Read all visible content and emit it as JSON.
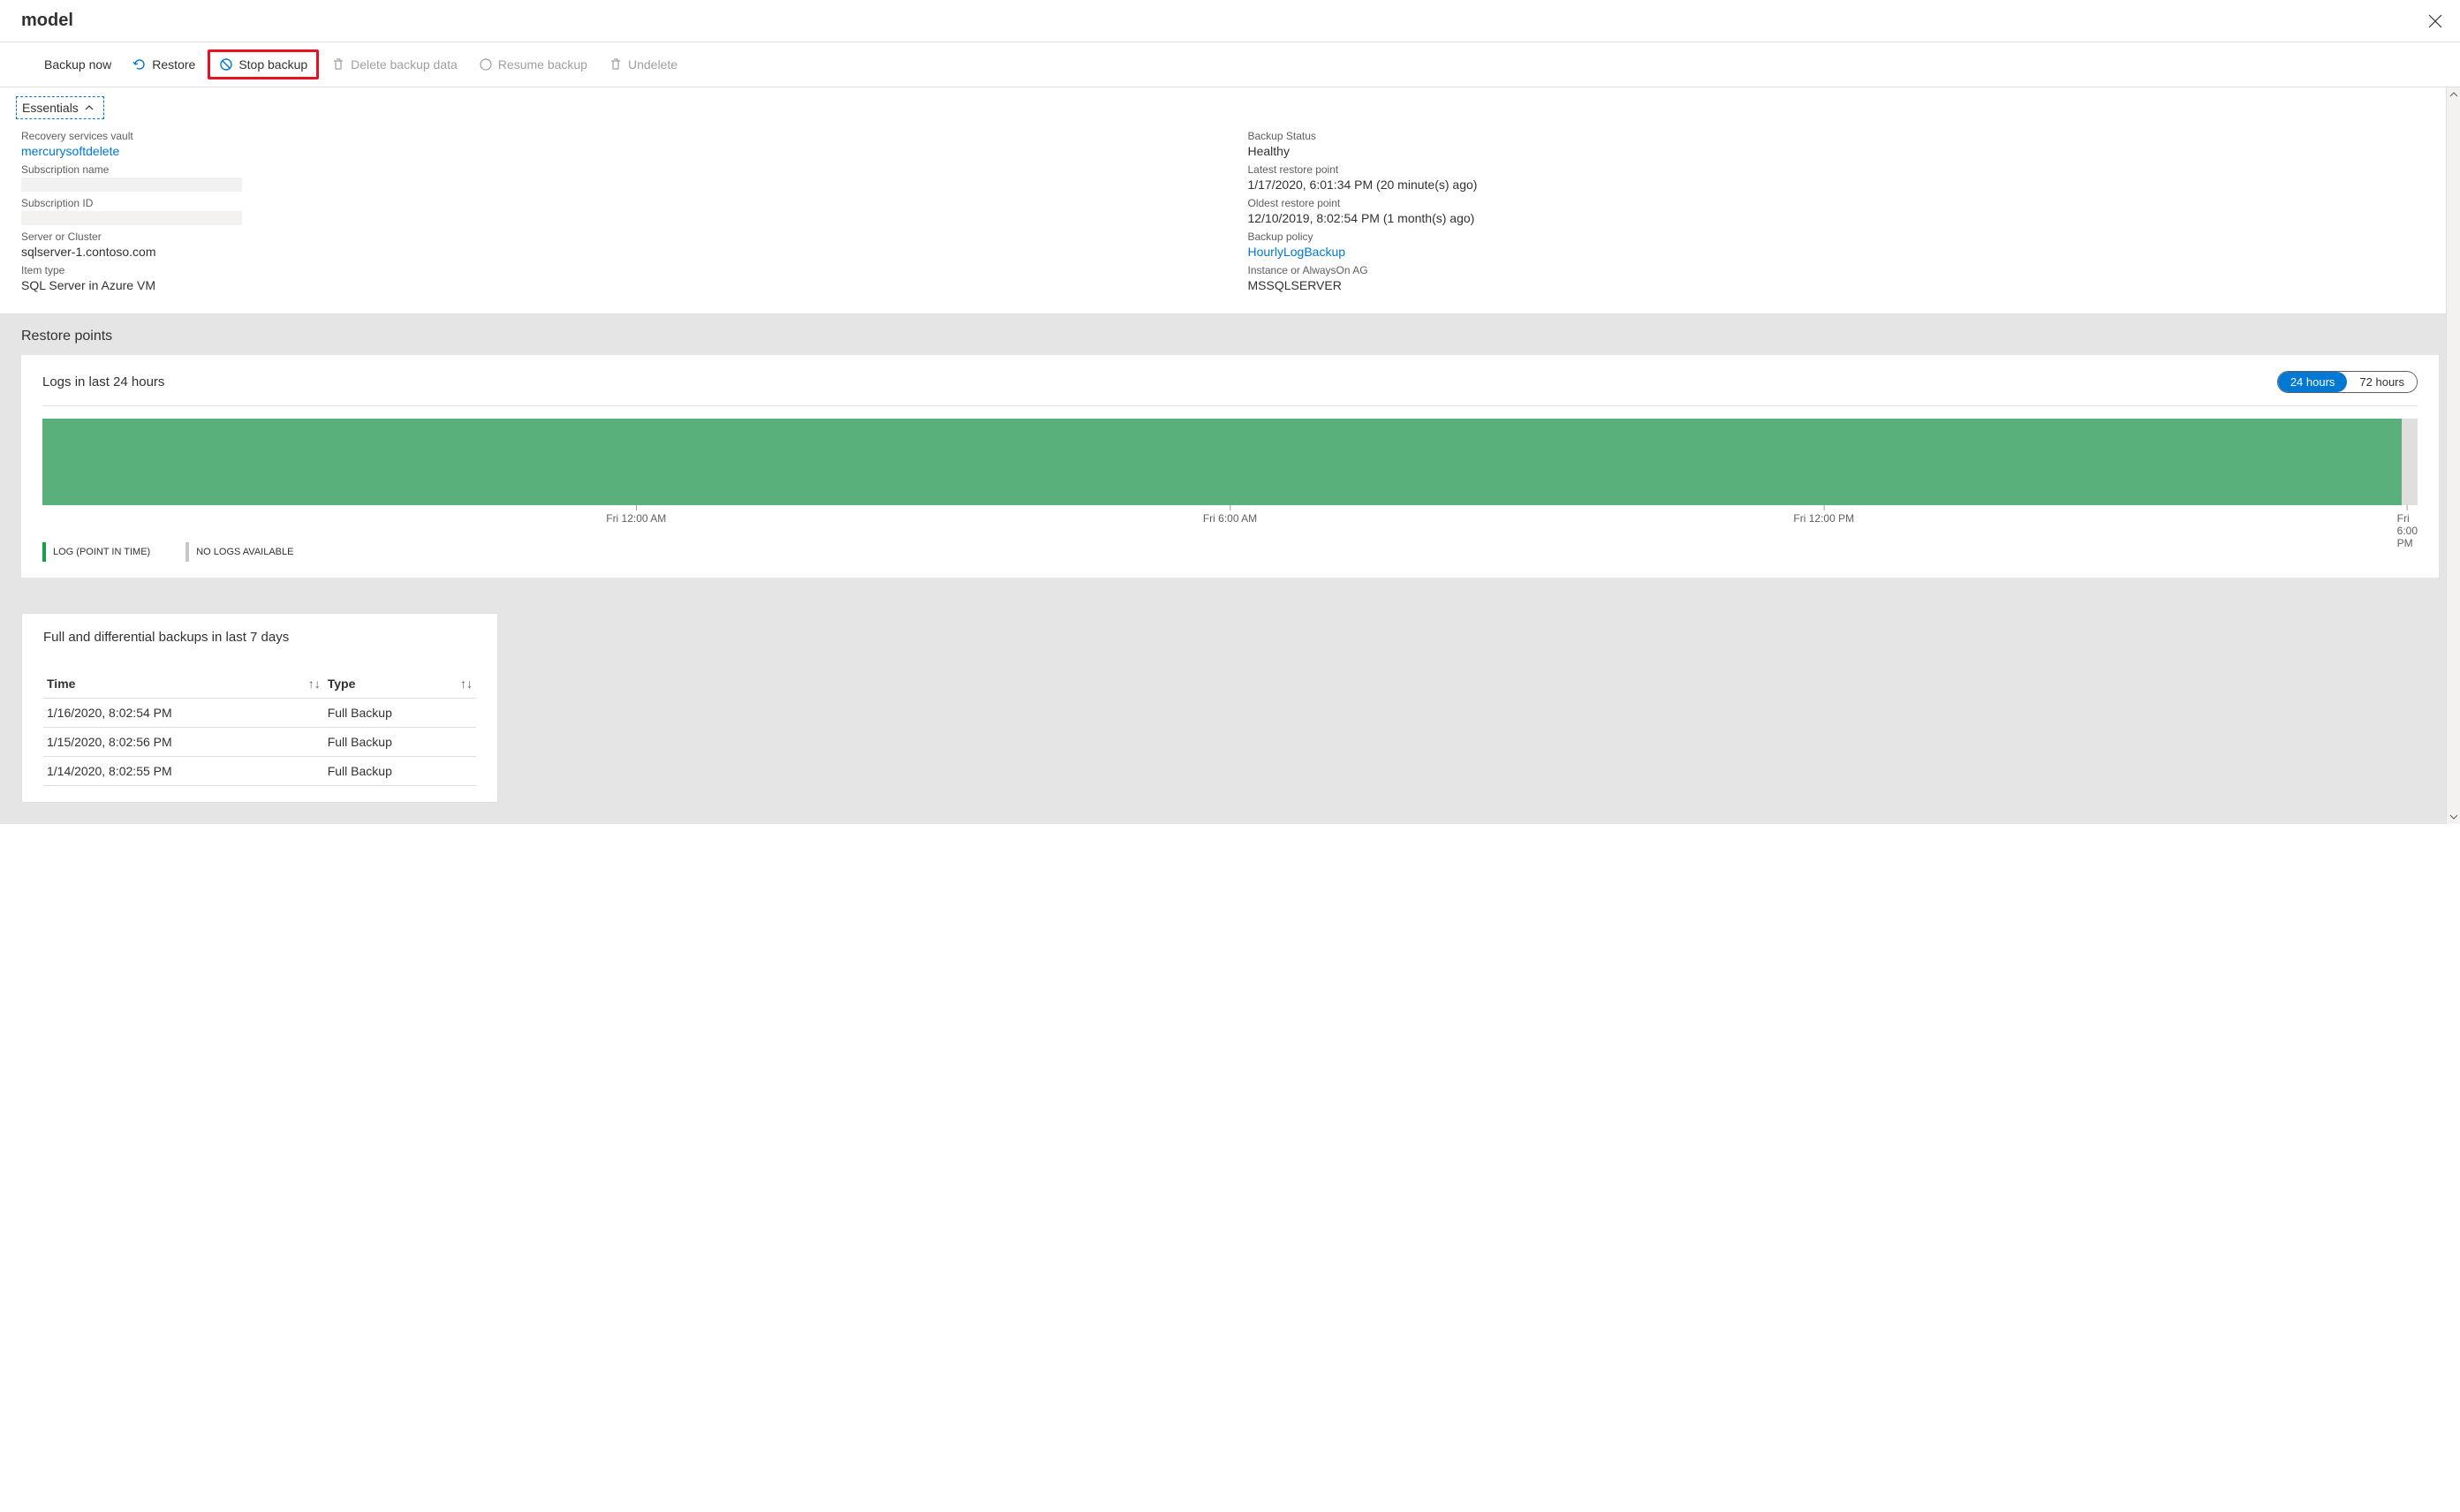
{
  "header": {
    "title": "model"
  },
  "toolbar": {
    "backup_now": "Backup now",
    "restore": "Restore",
    "stop_backup": "Stop backup",
    "delete_backup_data": "Delete backup data",
    "resume_backup": "Resume backup",
    "undelete": "Undelete"
  },
  "essentials": {
    "toggle_label": "Essentials",
    "left": {
      "recovery_vault_label": "Recovery services vault",
      "recovery_vault_value": "mercurysoftdelete",
      "subscription_name_label": "Subscription name",
      "subscription_id_label": "Subscription ID",
      "server_label": "Server or Cluster",
      "server_value": "sqlserver-1.contoso.com",
      "item_type_label": "Item type",
      "item_type_value": "SQL Server in Azure VM"
    },
    "right": {
      "backup_status_label": "Backup Status",
      "backup_status_value": "Healthy",
      "latest_restore_label": "Latest restore point",
      "latest_restore_value": "1/17/2020, 6:01:34 PM (20 minute(s) ago)",
      "oldest_restore_label": "Oldest restore point",
      "oldest_restore_value": "12/10/2019, 8:02:54 PM (1 month(s) ago)",
      "backup_policy_label": "Backup policy",
      "backup_policy_value": "HourlyLogBackup",
      "instance_label": "Instance or AlwaysOn AG",
      "instance_value": "MSSQLSERVER"
    }
  },
  "restore_points": {
    "section_title": "Restore points",
    "logs_title": "Logs in last 24 hours",
    "toggle": {
      "opt24": "24 hours",
      "opt72": "72 hours"
    },
    "legend": {
      "log": "LOG (POINT IN TIME)",
      "no_logs": "NO LOGS AVAILABLE"
    }
  },
  "chart_data": {
    "type": "bar",
    "title": "Logs in last 24 hours",
    "xlabel": "",
    "ylabel": "",
    "categories": [
      "Fri 12:00 AM",
      "Fri 6:00 AM",
      "Fri 12:00 PM",
      "Fri 6:00 PM"
    ],
    "series": [
      {
        "name": "LOG (POINT IN TIME)",
        "color": "#59b07b",
        "range_fraction": [
          0.0,
          0.985
        ]
      },
      {
        "name": "NO LOGS AVAILABLE",
        "color": "#e1dfdd",
        "range_fraction": [
          0.985,
          1.0
        ]
      }
    ],
    "x_range_hours": [
      0,
      18
    ],
    "ticks": [
      {
        "label": "Fri 12:00 AM",
        "pos": 0.25
      },
      {
        "label": "Fri 6:00 AM",
        "pos": 0.5
      },
      {
        "label": "Fri 12:00 PM",
        "pos": 0.75
      },
      {
        "label": "Fri 6:00 PM",
        "pos": 1.0
      }
    ]
  },
  "backups_table": {
    "title": "Full and differential backups in last 7 days",
    "col_time": "Time",
    "col_type": "Type",
    "rows": [
      {
        "time": "1/16/2020, 8:02:54 PM",
        "type": "Full Backup"
      },
      {
        "time": "1/15/2020, 8:02:56 PM",
        "type": "Full Backup"
      },
      {
        "time": "1/14/2020, 8:02:55 PM",
        "type": "Full Backup"
      }
    ]
  }
}
